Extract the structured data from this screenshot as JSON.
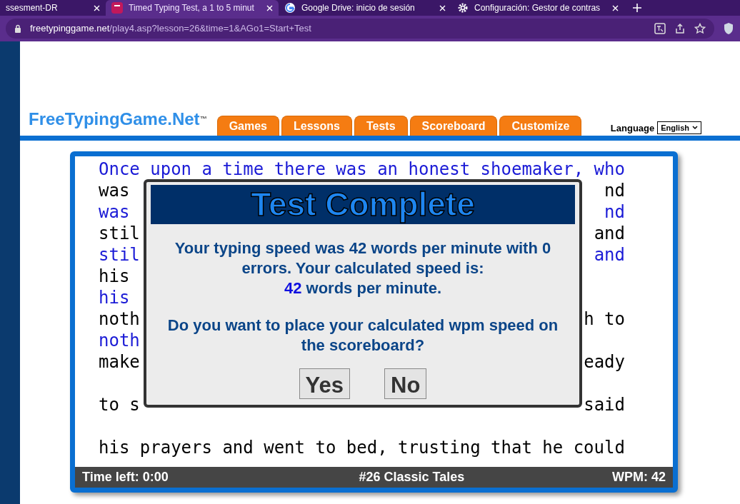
{
  "browser": {
    "tabs": [
      {
        "title": "ssesment-DR",
        "selected": false
      },
      {
        "title": "Timed Typing Test, a 1 to 5 minut",
        "selected": true
      },
      {
        "title": "Google Drive: inicio de sesión",
        "selected": false
      },
      {
        "title": "Configuración: Gestor de contras",
        "selected": false
      }
    ],
    "url_host": "freetypinggame.net",
    "url_path": "/play4.asp?lesson=26&time=1&AGo1=Start+Test"
  },
  "site": {
    "logo": "FreeTypingGame.Net",
    "logo_mark": "™",
    "nav": [
      "Games",
      "Lessons",
      "Tests",
      "Scoreboard",
      "Customize"
    ],
    "language_label": "Language",
    "language_value": "English"
  },
  "text_rows": [
    {
      "kind": "text",
      "left": "Once upon a time there was an honest shoemaker, who",
      "typed": true
    },
    {
      "kind": "text",
      "left": "was",
      "right": "nd",
      "typed": false
    },
    {
      "kind": "text",
      "left": "was",
      "right": "nd",
      "typed": true
    },
    {
      "kind": "text",
      "left": "stil",
      "right": "and",
      "typed": false
    },
    {
      "kind": "text",
      "left": "stil",
      "right": "and",
      "typed": true
    },
    {
      "kind": "text",
      "left": "his",
      "typed": false
    },
    {
      "kind": "text",
      "left": "his",
      "typed": true
    },
    {
      "kind": "text",
      "left": "noth",
      "right": "h to",
      "typed": false
    },
    {
      "kind": "text",
      "left": "noth",
      "typed": true
    },
    {
      "kind": "text",
      "left": "make",
      "right": "eady",
      "typed": false
    },
    {
      "kind": "blank"
    },
    {
      "kind": "text",
      "left": "to s",
      "right": "said",
      "typed": false
    },
    {
      "kind": "blank"
    },
    {
      "kind": "text",
      "left": "his prayers and went to bed, trusting that he could",
      "typed": false
    }
  ],
  "status": {
    "time_left": "Time left: 0:00",
    "lesson": "#26 Classic Tales",
    "wpm": "WPM: 42"
  },
  "dialog": {
    "title": "Test Complete",
    "message": "Your typing speed was 42 words per minute with 0 errors. Your calculated speed is:",
    "speed": "42",
    "speed_suffix": " words per minute.",
    "question": "Do you want to place your calculated wpm speed on the scoreboard?",
    "buttons": [
      "Yes",
      "No"
    ]
  }
}
